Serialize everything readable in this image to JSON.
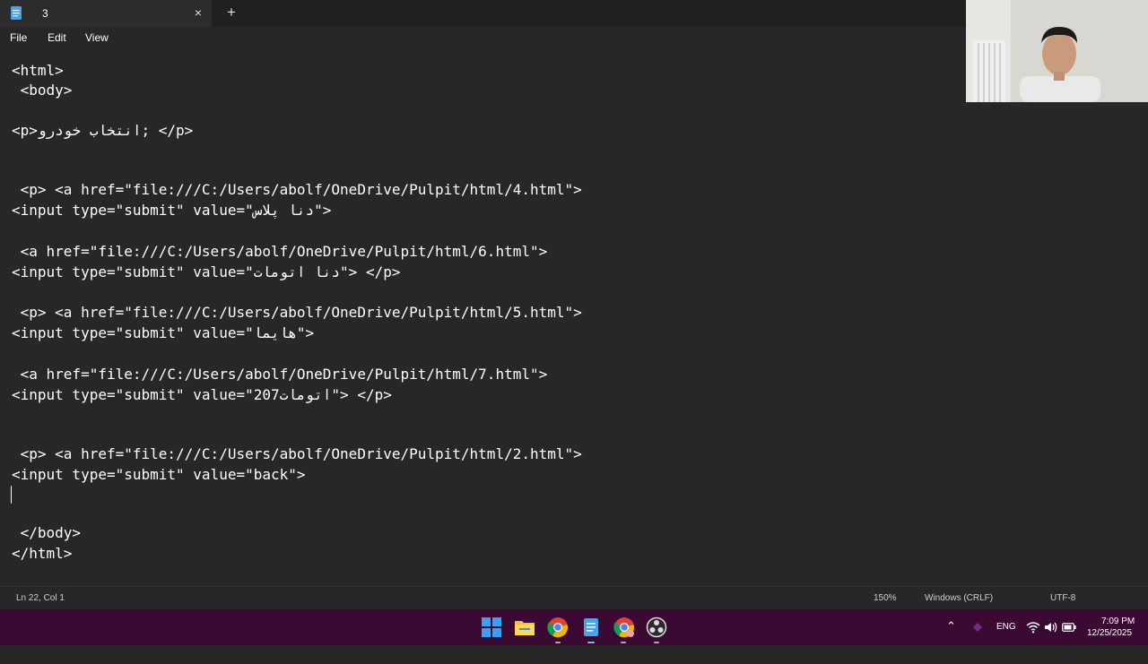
{
  "tab": {
    "title": "3",
    "close_glyph": "×",
    "new_tab_glyph": "+"
  },
  "menu": {
    "file": "File",
    "edit": "Edit",
    "view": "View"
  },
  "editor": {
    "lines": [
      "<html>",
      " <body>",
      "",
      "<p>انتخاب خودرو; </p>",
      "",
      "",
      " <p> <a href=\"file:///C:/Users/abolf/OneDrive/Pulpit/html/4.html\">",
      "<input type=\"submit\" value=\"دنا پلاس\">",
      "",
      " <a href=\"file:///C:/Users/abolf/OneDrive/Pulpit/html/6.html\">",
      "<input type=\"submit\" value=\"دنا اتومات\"> </p>",
      "",
      " <p> <a href=\"file:///C:/Users/abolf/OneDrive/Pulpit/html/5.html\">",
      "<input type=\"submit\" value=\"هایما\">",
      "",
      " <a href=\"file:///C:/Users/abolf/OneDrive/Pulpit/html/7.html\">",
      "<input type=\"submit\" value=\"207اتومات\"> </p>",
      "",
      "",
      " <p> <a href=\"file:///C:/Users/abolf/OneDrive/Pulpit/html/2.html\">",
      "<input type=\"submit\" value=\"back\">",
      "",
      "",
      " </body>",
      "</html>"
    ]
  },
  "status": {
    "position": "Ln 22, Col 1",
    "zoom": "150%",
    "line_ending": "Windows (CRLF)",
    "encoding": "UTF-8"
  },
  "taskbar": {
    "language": "ENG",
    "time": "7:09 PM",
    "date": "12/25/2025",
    "icons": [
      "windows-start-icon",
      "file-explorer-icon",
      "chrome-icon",
      "notepad-icon",
      "chrome-profile-icon",
      "obs-icon"
    ]
  },
  "colors": {
    "editor_bg": "#272727",
    "taskbar_bg": "#3b0a33",
    "text": "#ffffff"
  }
}
